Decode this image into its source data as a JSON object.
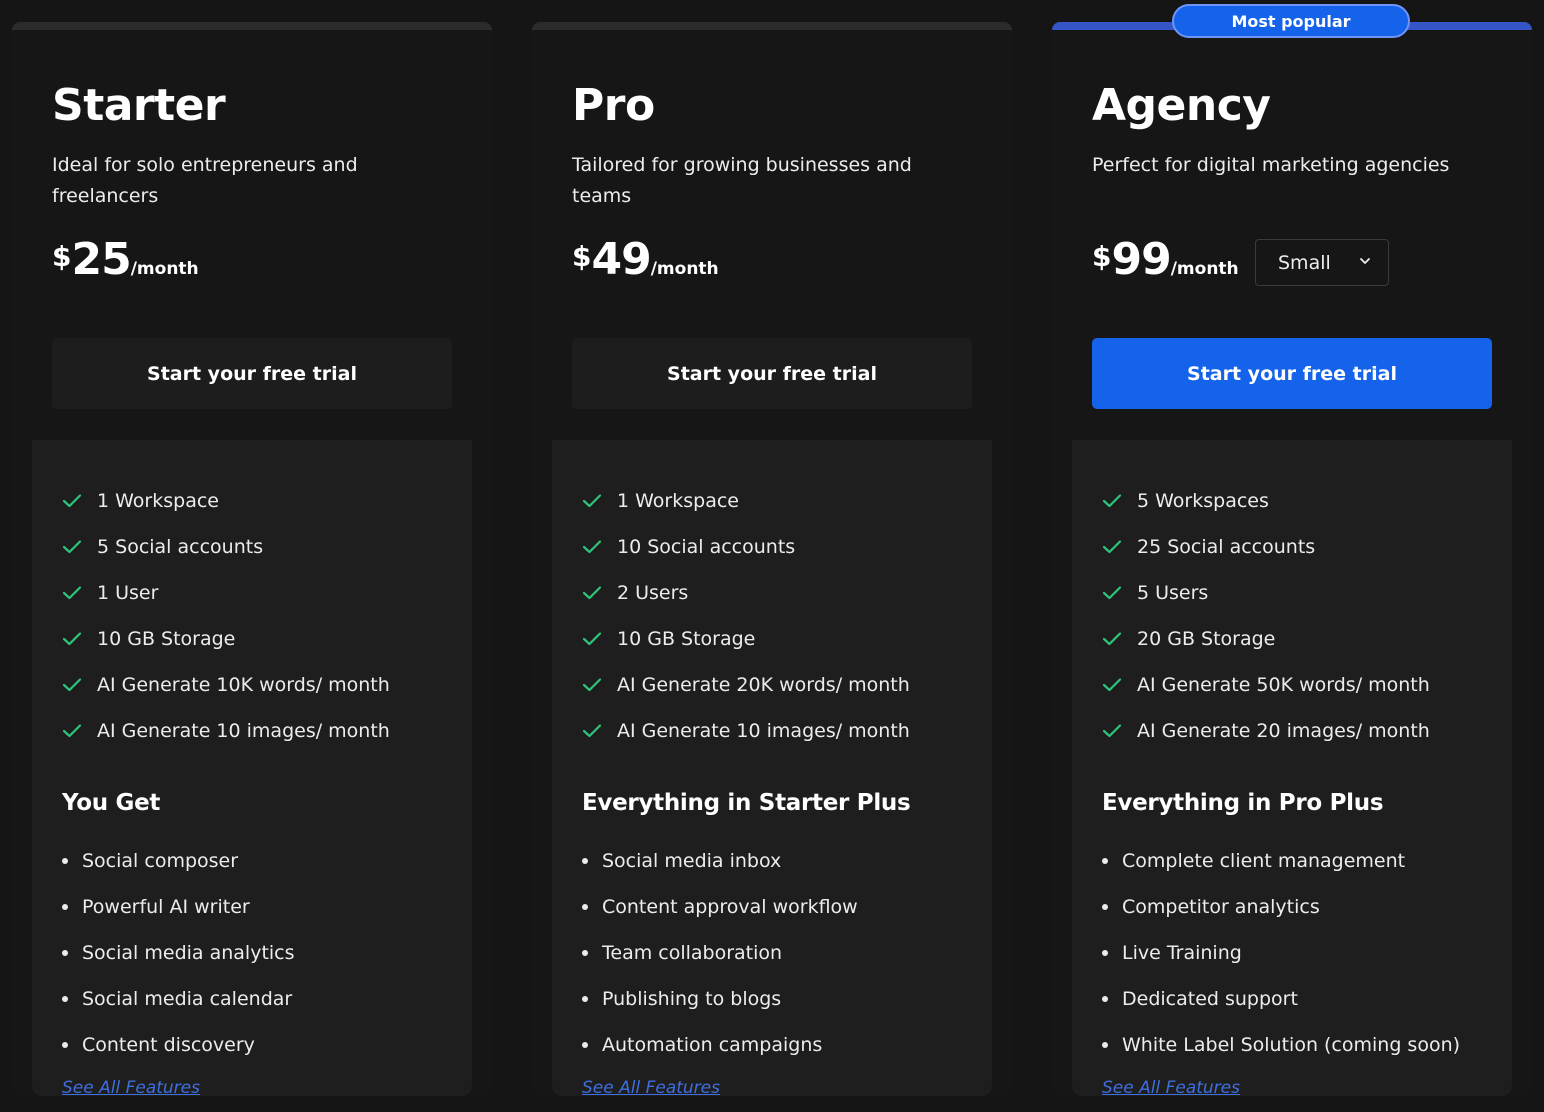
{
  "colors": {
    "background": "#151515",
    "accent": "#1463ea",
    "check": "#2ec47a",
    "link": "#3d6fe0"
  },
  "plans": [
    {
      "name": "Starter",
      "description": "Ideal for solo entrepreneurs and freelancers",
      "currency": "$",
      "price": "25",
      "period": "/month",
      "cta_label": "Start your free trial",
      "features": [
        "1 Workspace",
        "5 Social accounts",
        "1 User",
        "10 GB Storage",
        "AI Generate 10K words/ month",
        "AI Generate 10 images/ month"
      ],
      "includes_heading": "You Get",
      "includes": [
        "Social composer",
        "Powerful AI writer",
        "Social media analytics",
        "Social media calendar",
        "Content discovery"
      ],
      "see_all_label": "See All Features"
    },
    {
      "name": "Pro",
      "description": "Tailored for growing businesses and teams",
      "currency": "$",
      "price": "49",
      "period": "/month",
      "cta_label": "Start your free trial",
      "features": [
        "1 Workspace",
        "10 Social accounts",
        "2 Users",
        "10 GB Storage",
        "AI Generate 20K words/ month",
        "AI Generate 10 images/ month"
      ],
      "includes_heading": "Everything in Starter Plus",
      "includes": [
        "Social media inbox",
        "Content approval workflow",
        "Team collaboration",
        "Publishing to blogs",
        "Automation campaigns"
      ],
      "see_all_label": "See All Features"
    },
    {
      "name": "Agency",
      "badge": "Most popular",
      "description": "Perfect for digital marketing agencies",
      "currency": "$",
      "price": "99",
      "period": "/month",
      "size_select": {
        "value": "Small",
        "icon": "chevron-down-icon"
      },
      "cta_label": "Start your free trial",
      "features": [
        "5 Workspaces",
        "25 Social accounts",
        "5 Users",
        "20 GB Storage",
        "AI Generate 50K words/ month",
        "AI Generate 20 images/ month"
      ],
      "includes_heading": "Everything in Pro Plus",
      "includes": [
        "Complete client management",
        "Competitor analytics",
        "Live Training",
        "Dedicated support",
        "White Label Solution (coming soon)"
      ],
      "see_all_label": "See All Features"
    }
  ]
}
